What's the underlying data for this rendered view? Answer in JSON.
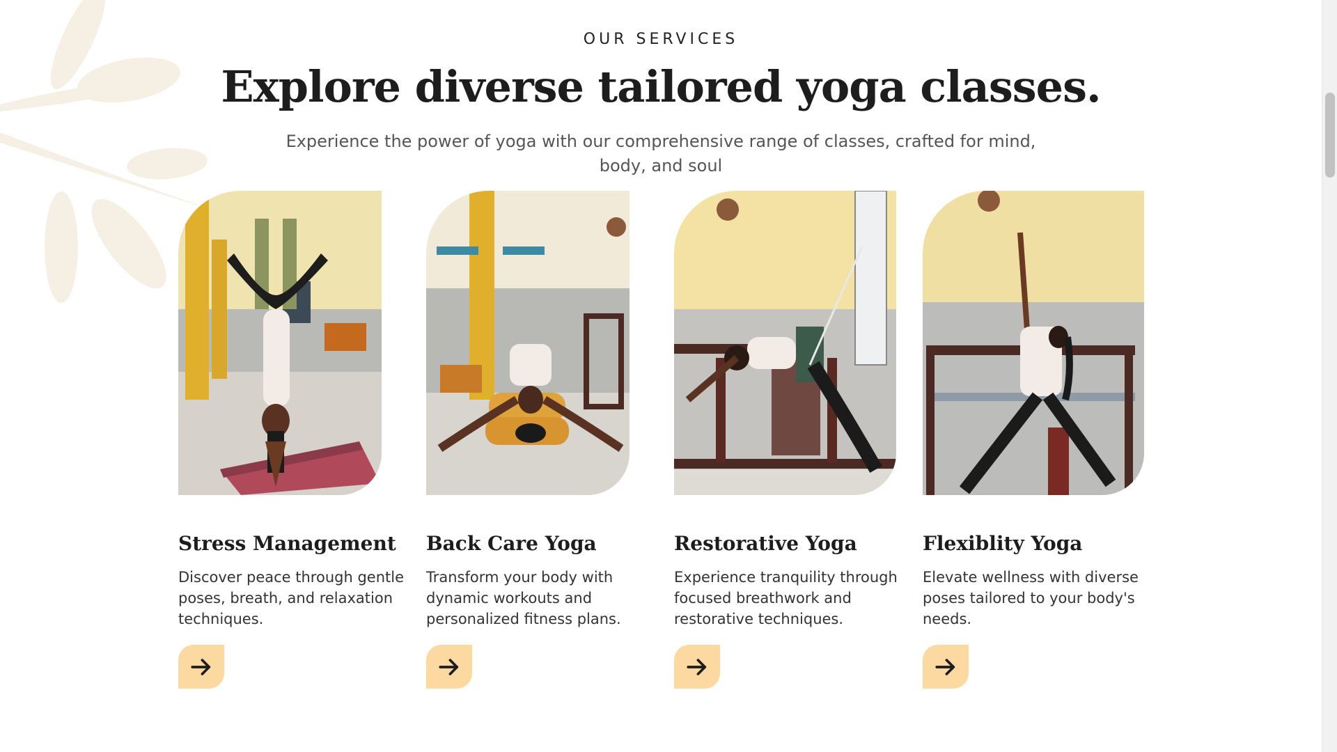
{
  "section": {
    "eyebrow": "OUR SERVICES",
    "headline": "Explore diverse tailored yoga classes.",
    "lead": "Experience the power of yoga with our comprehensive range of classes, crafted for mind, body, and soul"
  },
  "services": [
    {
      "title": "Stress Management",
      "description": "Discover peace through gentle poses, breath, and relaxation techniques.",
      "button_icon": "arrow-right-icon"
    },
    {
      "title": "Back Care Yoga",
      "description": "Transform your body with dynamic workouts and personalized fitness plans.",
      "button_icon": "arrow-right-icon"
    },
    {
      "title": "Restorative Yoga",
      "description": "Experience tranquility through focused breathwork and restorative techniques.",
      "button_icon": "arrow-right-icon"
    },
    {
      "title": "Flexiblity Yoga",
      "description": "Elevate wellness with diverse poses tailored to your body's needs.",
      "button_icon": "arrow-right-icon"
    }
  ],
  "colors": {
    "button_bg": "#fcd9a0",
    "leaf": "#f5efe4",
    "wall_yellow": "#f3e2a4",
    "wall_grey": "#b9b9b5",
    "floor": "#d9d6d0"
  }
}
